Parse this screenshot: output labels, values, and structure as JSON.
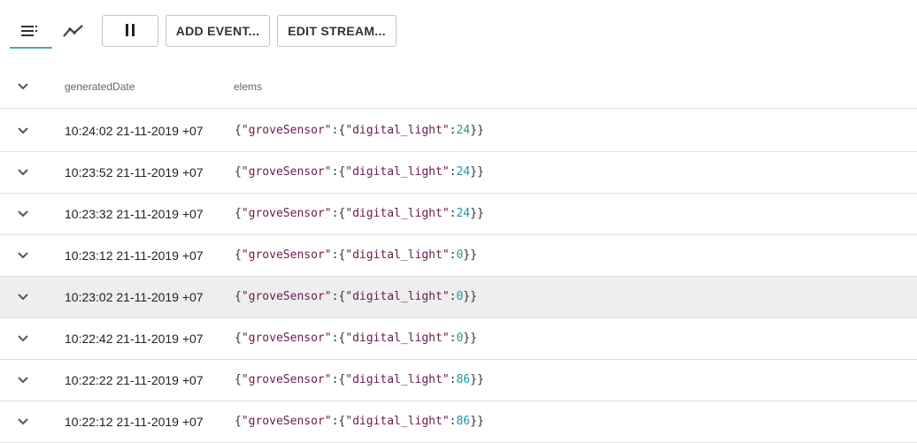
{
  "toolbar": {
    "tabs": [
      {
        "name": "list-view",
        "icon": "list-icon",
        "active": true
      },
      {
        "name": "chart-view",
        "icon": "line-chart-icon",
        "active": false
      }
    ],
    "pause_icon": "pause-icon",
    "add_event_label": "ADD EVENT...",
    "edit_stream_label": "EDIT STREAM...",
    "accent_color": "#4aa8c8"
  },
  "table": {
    "headers": {
      "generated_date": "generatedDate",
      "elems": "elems"
    },
    "rows": [
      {
        "date": "10:24:02 21-11-2019 +07",
        "key1": "groveSensor",
        "key2": "digital_light",
        "value": "24",
        "highlight": false
      },
      {
        "date": "10:23:52 21-11-2019 +07",
        "key1": "groveSensor",
        "key2": "digital_light",
        "value": "24",
        "highlight": false
      },
      {
        "date": "10:23:32 21-11-2019 +07",
        "key1": "groveSensor",
        "key2": "digital_light",
        "value": "24",
        "highlight": false
      },
      {
        "date": "10:23:12 21-11-2019 +07",
        "key1": "groveSensor",
        "key2": "digital_light",
        "value": "0",
        "highlight": false
      },
      {
        "date": "10:23:02 21-11-2019 +07",
        "key1": "groveSensor",
        "key2": "digital_light",
        "value": "0",
        "highlight": true
      },
      {
        "date": "10:22:42 21-11-2019 +07",
        "key1": "groveSensor",
        "key2": "digital_light",
        "value": "0",
        "highlight": false
      },
      {
        "date": "10:22:22 21-11-2019 +07",
        "key1": "groveSensor",
        "key2": "digital_light",
        "value": "86",
        "highlight": false
      },
      {
        "date": "10:22:12 21-11-2019 +07",
        "key1": "groveSensor",
        "key2": "digital_light",
        "value": "86",
        "highlight": false
      }
    ],
    "key_color": "#6a1b4d",
    "number_color": "#1a9a9a",
    "highlight_color": "#eeeeee"
  }
}
